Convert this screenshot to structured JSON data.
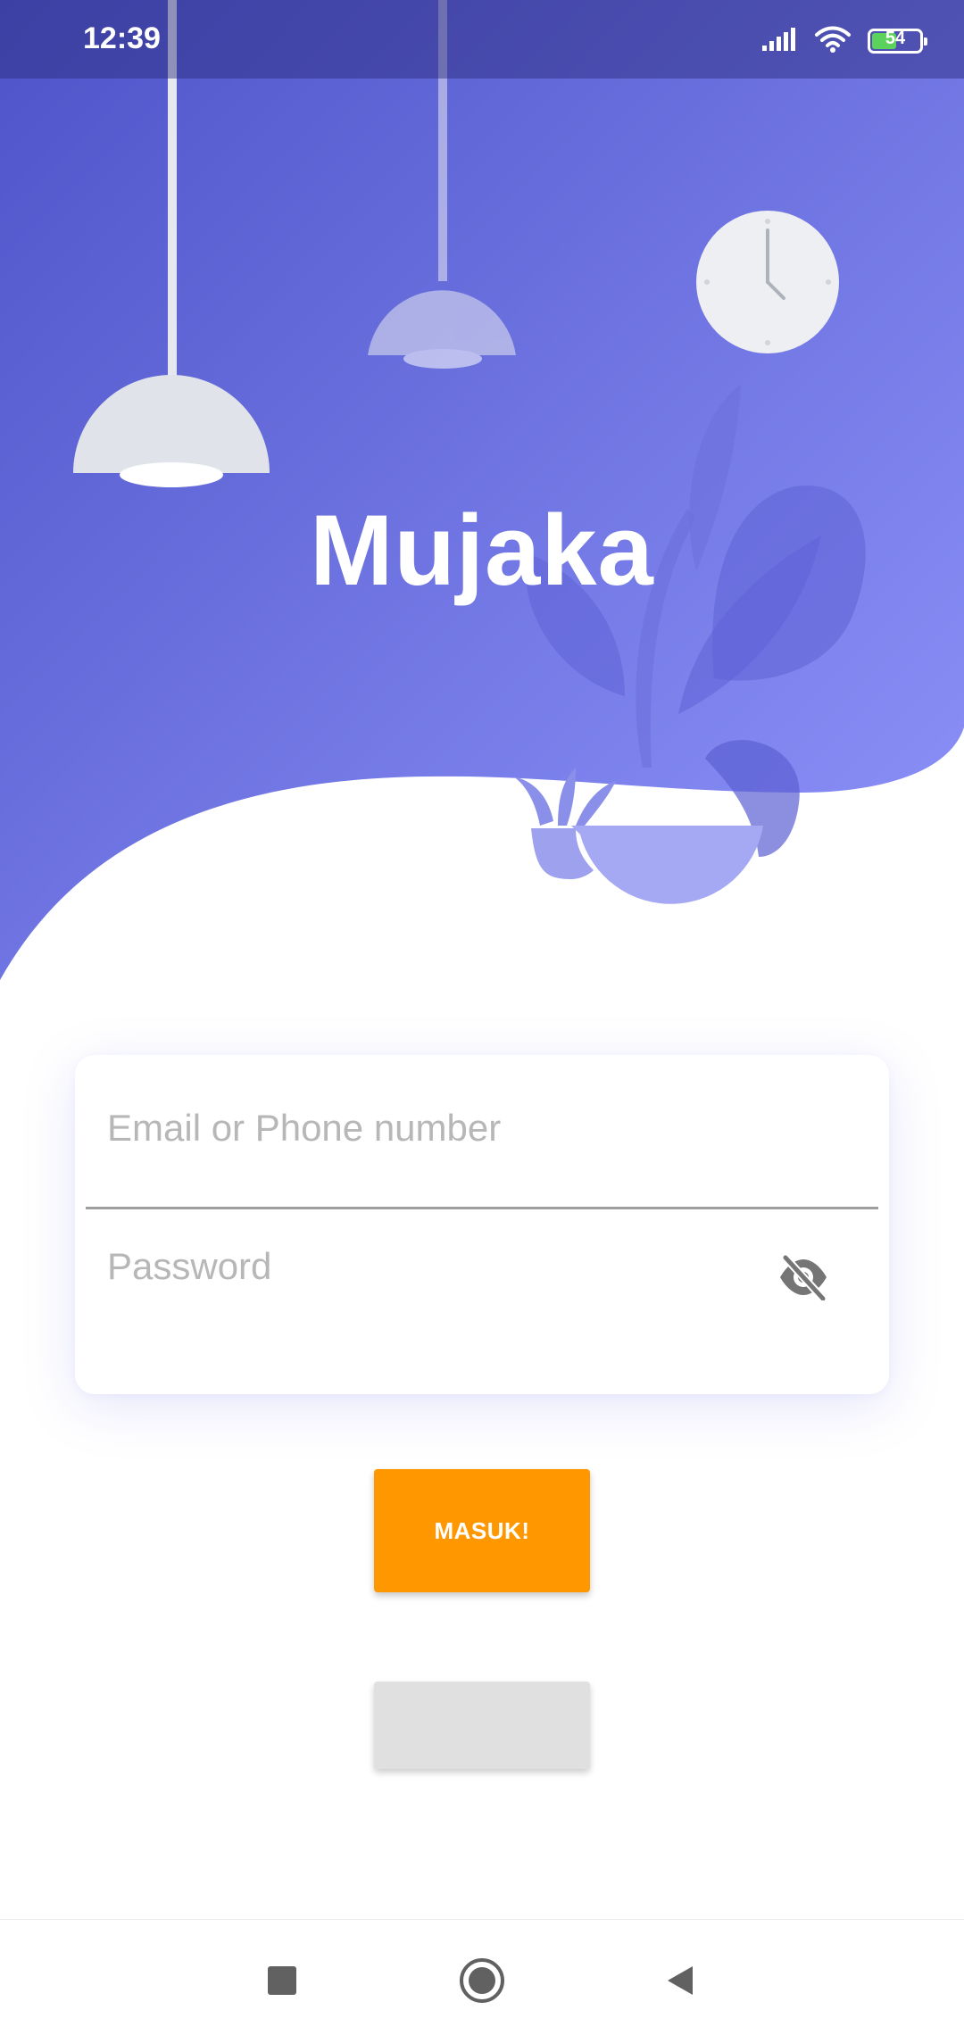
{
  "status_bar": {
    "time": "12:39",
    "battery_level": "54",
    "icons": [
      "signal-icon",
      "wifi-icon",
      "battery-icon"
    ]
  },
  "header": {
    "app_title": "Mujaka",
    "illustration": [
      "lamp-icon",
      "lamp-icon",
      "clock-icon",
      "plant-icon"
    ]
  },
  "login_form": {
    "email_placeholder": "Email or Phone number",
    "email_value": "",
    "password_placeholder": "Password",
    "password_value": "",
    "visibility_icon": "eye-off-icon"
  },
  "actions": {
    "login_label": "MASUK!",
    "secondary_label": ""
  },
  "navigation": {
    "items": [
      "recents-icon",
      "home-icon",
      "back-icon"
    ]
  },
  "colors": {
    "gradient_start": "#4e54c8",
    "gradient_end": "#8f94fb",
    "accent": "#ff9800",
    "secondary_button": "#e0e0e0"
  }
}
